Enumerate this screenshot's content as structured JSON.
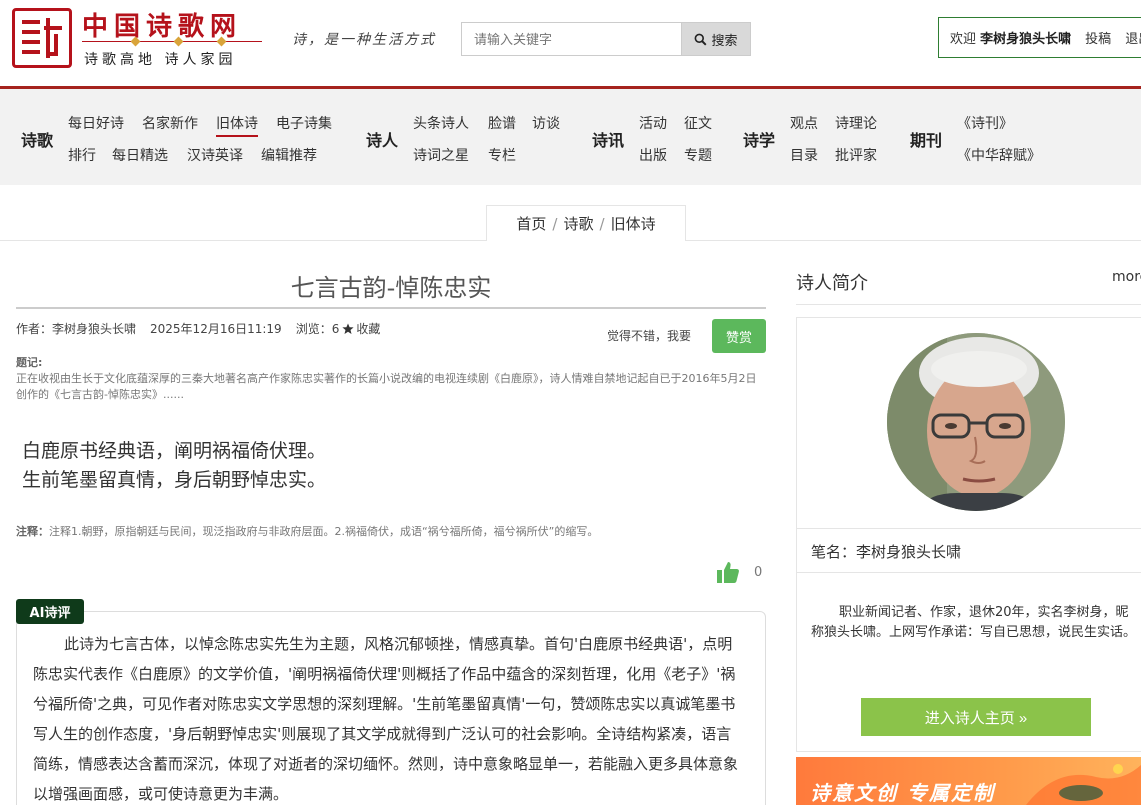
{
  "header": {
    "site_title": "中国诗歌网",
    "site_subtitle": "诗歌高地 诗人家园",
    "slogan": "诗，是一种生活方式",
    "search_placeholder": "请输入关键字",
    "search_label": "搜索",
    "welcome_prefix": "欢迎",
    "username": "李树身狼头长啸",
    "submit_link": "投稿",
    "logout_link": "退出"
  },
  "nav": {
    "groups": [
      {
        "head": "诗歌",
        "links": [
          "每日好诗",
          "名家新作",
          "旧体诗",
          "电子诗集",
          "排行",
          "每日精选",
          "汉诗英译",
          "编辑推荐"
        ]
      },
      {
        "head": "诗人",
        "links": [
          "头条诗人",
          "脸谱",
          "访谈",
          "诗词之星",
          "专栏"
        ]
      },
      {
        "head": "诗讯",
        "links": [
          "活动",
          "征文",
          "出版",
          "专题"
        ]
      },
      {
        "head": "诗学",
        "links": [
          "观点",
          "诗理论",
          "目录",
          "批评家"
        ]
      },
      {
        "head": "期刊",
        "links": [
          "《诗刊》",
          "《中华辞赋》"
        ]
      }
    ]
  },
  "breadcrumb": {
    "items": [
      "首页",
      "诗歌",
      "旧体诗"
    ],
    "sep": "/"
  },
  "poem": {
    "title": "七言古韵-悼陈忠实",
    "author_label": "作者：李树身狼头长啸",
    "datetime": "2025年12月16日11:19",
    "views_label": "浏览：6",
    "favorite_label": "收藏",
    "praise_prompt": "觉得不错，我要",
    "praise_button": "赞赏",
    "note_label": "题记:",
    "note_text": "正在收视由生长于文化底蕴深厚的三秦大地著名高产作家陈忠实著作的长篇小说改编的电视连续剧《白鹿原》，诗人情难自禁地记起自已于2016年5月2日创作的《七言古韵-悼陈忠实》......",
    "lines": [
      "白鹿原书经典语，阐明祸福倚伏理。",
      "生前笔墨留真情，身后朝野悼忠实。"
    ],
    "annotation_label": "注释：",
    "annotation_text": "注释1.朝野，原指朝廷与民间，现泛指政府与非政府层面。2.祸福倚伏，成语“祸兮福所倚，福兮祸所伏”的缩写。",
    "like_count": "0"
  },
  "ai_review": {
    "tag": "AI诗评",
    "text": "此诗为七言古体，以悼念陈忠实先生为主题，风格沉郁顿挫，情感真挚。首句'白鹿原书经典语'，点明陈忠实代表作《白鹿原》的文学价值，'阐明祸福倚伏理'则概括了作品中蕴含的深刻哲理，化用《老子》'祸兮福所倚'之典，可见作者对陈忠实文学思想的深刻理解。'生前笔墨留真情'一句，赞颂陈忠实以真诚笔墨书写人生的创作态度，'身后朝野悼忠实'则展现了其文学成就得到广泛认可的社会影响。全诗结构紧凑，语言简练，情感表达含蓄而深沉，体现了对逝者的深切缅怀。然则，诗中意象略显单一，若能融入更多具体意象以增强画面感，或可使诗意更为丰满。"
  },
  "sidebar": {
    "head": "诗人简介",
    "more": "more",
    "pen_name_label": "笔名：李树身狼头长啸",
    "bio": "职业新闻记者、作家，退休20年，实名李树身，昵称狼头长啸。上网写作承诺：写自已思想，说民生实话。",
    "enter_button": "进入诗人主页 »",
    "banner_text": "诗意文创  专属定制"
  },
  "colors": {
    "brand_red": "#b5121b",
    "praise_green": "#5cb85c",
    "enter_green": "#8bc34a",
    "ai_tag": "#0f3a1a"
  }
}
